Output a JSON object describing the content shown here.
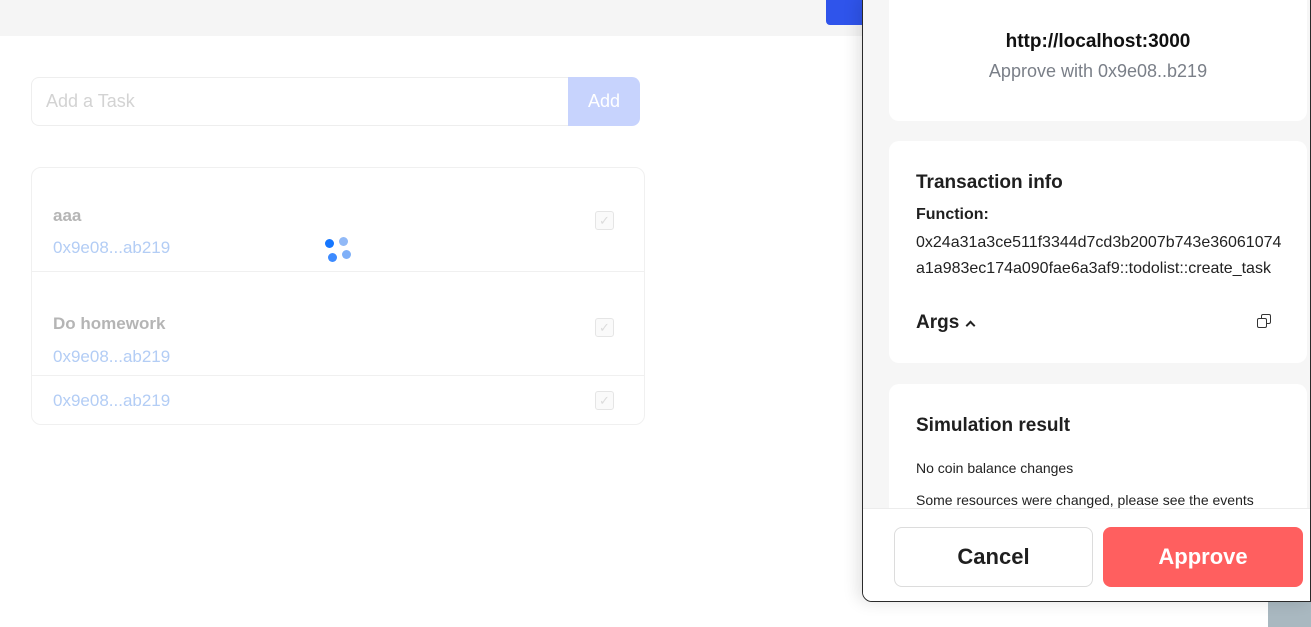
{
  "app": {
    "task_input": {
      "placeholder": "Add a Task",
      "value": ""
    },
    "add_button": "Add",
    "tasks": [
      {
        "title": "aaa",
        "address": "0x9e08...ab219"
      },
      {
        "title": "Do homework",
        "address": "0x9e08...ab219"
      },
      {
        "title": "",
        "address": "0x9e08...ab219"
      }
    ]
  },
  "wallet": {
    "origin": {
      "url": "http://localhost:3000",
      "account": "Approve with 0x9e08..b219"
    },
    "transaction": {
      "title": "Transaction info",
      "function_label": "Function:",
      "function_value": "0x24a31a3ce511f3344d7cd3b2007b743e36061074a1a983ec174a090fae6a3af9::todolist::create_task",
      "args_label": "Args"
    },
    "simulation": {
      "title": "Simulation result",
      "line1": "No coin balance changes",
      "line2": "Some resources were changed, please see the events"
    },
    "buttons": {
      "cancel": "Cancel",
      "approve": "Approve"
    }
  },
  "colors": {
    "accent": "#2f54eb",
    "approve": "#ff5f5f",
    "address_link": "#b3cdf5",
    "spinner": "#1677ff"
  }
}
